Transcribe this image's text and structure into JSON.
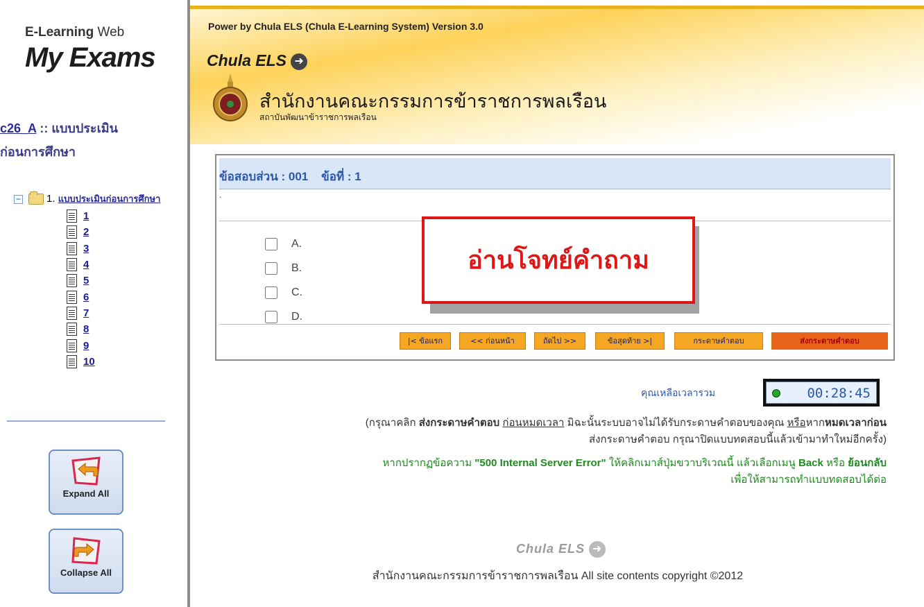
{
  "sidebar": {
    "brand_small_a": "E-Learning",
    "brand_small_b": "Web",
    "brand_big": "My Exams",
    "course_code": "c26_A",
    "course_sep": " :: แบบประเมิน",
    "course_line2": "ก่อนการศึกษา",
    "tree_root_num": "1.",
    "tree_root_label": "แบบประเมินก่อนการศึกษา",
    "tree_items": [
      "1",
      "2",
      "3",
      "4",
      "5",
      "6",
      "7",
      "8",
      "9",
      "10"
    ],
    "expand_label": "Expand All",
    "collapse_label": "Collapse All"
  },
  "header": {
    "power_text": "Power by Chula ELS (Chula E-Learning System) Version 3.0",
    "els_logo": "Chula ELS",
    "org_name": "สำนักงานคณะกรรมการข้าราชการพลเรือน",
    "org_sub": "สถาบันพัฒนาข้าราชการพลเรือน"
  },
  "exam": {
    "section_heading": "ข้อสอบส่วน : 001    ข้อที่ : 1",
    "question_text": ".",
    "choices": [
      "A.",
      "B.",
      "C.",
      "D."
    ],
    "nav": {
      "first": "|< ข้อแรก",
      "prev": "<< ก่อนหน้า",
      "next": "ถัดไป >>",
      "last": "ข้อสุดท้าย >|",
      "answer_sheet": "กระดาษคำตอบ",
      "submit": "ส่งกระดาษคำตอบ"
    }
  },
  "callout_text": "อ่านโจทย์คำถาม",
  "timer": {
    "label": "คุณเหลือเวลารวม",
    "value": "00:28:45"
  },
  "notes": {
    "n1_a": "(กรุณาคลิก ",
    "n1_b": "ส่งกระดาษคำตอบ",
    "n1_c": " ",
    "n1_d": "ก่อนหมดเวลา",
    "n1_e": " มิฉะนั้นระบบอาจไม่ได้รับกระดาษคำตอบของคุณ ",
    "n1_f": "หรือ",
    "n1_g": "หาก",
    "n1_h": "หมดเวลาก่อน",
    "n1_line2": "ส่งกระดาษคำตอบ กรุณาปิดแบบทดสอบนี้แล้วเข้ามาทำใหม่อีกครั้ง)",
    "n2_a": "หากปรากฏข้อความ ",
    "n2_b": "\"500 Internal Server Error\"",
    "n2_c": " ให้คลิกเมาส์ปุ่มขวาบริเวณนี้ แล้วเลือกเมนู ",
    "n2_d": "Back",
    "n2_e": " หรือ ",
    "n2_f": "ย้อนกลับ",
    "n2_line2": "เพื่อให้สามารถทำแบบทดสอบได้ต่อ"
  },
  "footer": {
    "logo": "Chula ELS",
    "copyright": "สำนักงานคณะกรรมการข้าราชการพลเรือน All site contents copyright ©2012"
  },
  "icons": {
    "tree_toggle": "minus-box-icon",
    "folder": "folder-open-icon",
    "doc": "document-icon",
    "expand": "expand-arrow-icon",
    "collapse": "collapse-arrow-icon",
    "logo_arrow": "arrow-right-circle-icon"
  },
  "colors": {
    "header_gold": "#fdd25a",
    "callout_red": "#e01616",
    "nav_orange": "#f5a623",
    "submit_orange": "#e8641b",
    "note_green": "#1f8a1f",
    "link_blue": "#2b58a8"
  }
}
